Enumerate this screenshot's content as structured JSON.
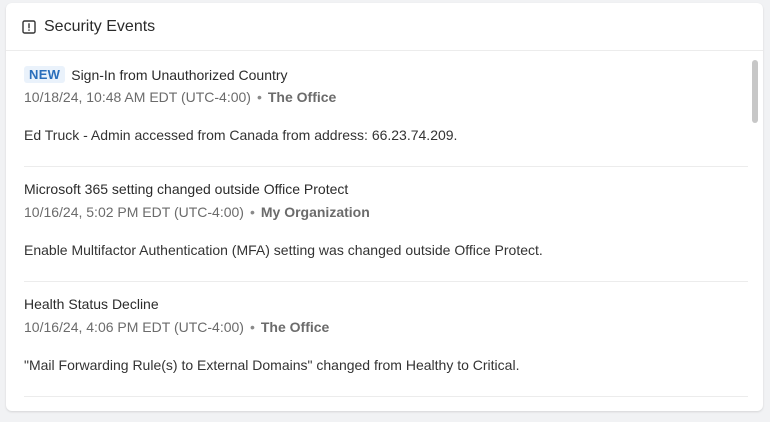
{
  "header": {
    "title": "Security Events",
    "icon": "alert-square-icon"
  },
  "events": [
    {
      "badge": "NEW",
      "title": "Sign-In from Unauthorized Country",
      "timestamp": "10/18/24, 10:48 AM EDT (UTC-4:00)",
      "separator": "•",
      "organization": "The Office",
      "description": "Ed Truck - Admin accessed from Canada from address: 66.23.74.209."
    },
    {
      "badge": "",
      "title": "Microsoft 365 setting changed outside Office Protect",
      "timestamp": "10/16/24, 5:02 PM EDT (UTC-4:00)",
      "separator": "•",
      "organization": "My Organization",
      "description": "Enable Multifactor Authentication (MFA) setting was changed outside Office Protect."
    },
    {
      "badge": "",
      "title": "Health Status Decline",
      "timestamp": "10/16/24, 4:06 PM EDT (UTC-4:00)",
      "separator": "•",
      "organization": "The Office",
      "description": "\"Mail Forwarding Rule(s) to External Domains\" changed from Healthy to Critical."
    }
  ],
  "colors": {
    "badge_text": "#2a6ebb",
    "background": "#f1f2f4",
    "card": "#ffffff"
  }
}
